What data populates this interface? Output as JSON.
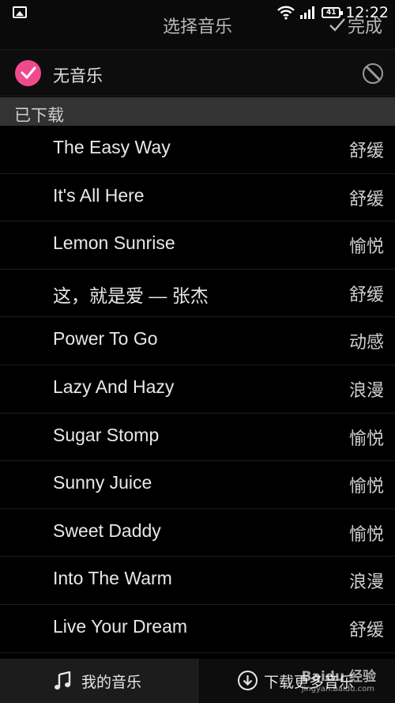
{
  "status_bar": {
    "time": "12:22",
    "battery": "41"
  },
  "header": {
    "title": "选择音乐",
    "done_label": "完成"
  },
  "no_music": {
    "label": "无音乐",
    "selected": true
  },
  "section": {
    "label": "已下载"
  },
  "tracks": [
    {
      "title": "The Easy Way",
      "mood": "舒缓"
    },
    {
      "title": "It's All Here",
      "mood": "舒缓"
    },
    {
      "title": "Lemon Sunrise",
      "mood": "愉悦"
    },
    {
      "title": "这，就是爱 — 张杰",
      "mood": "舒缓"
    },
    {
      "title": "Power To Go",
      "mood": "动感"
    },
    {
      "title": "Lazy And Hazy",
      "mood": "浪漫"
    },
    {
      "title": "Sugar Stomp",
      "mood": "愉悦"
    },
    {
      "title": "Sunny Juice",
      "mood": "愉悦"
    },
    {
      "title": "Sweet Daddy",
      "mood": "愉悦"
    },
    {
      "title": "Into The Warm",
      "mood": "浪漫"
    },
    {
      "title": "Live Your Dream",
      "mood": "舒缓"
    }
  ],
  "bottom_tabs": {
    "my_music": "我的音乐",
    "download_more": "下载更多音乐"
  },
  "watermark": {
    "brand": "Baidu 经验",
    "url": "jingyan.baidu.com"
  },
  "colors": {
    "accent": "#f04a8e",
    "background": "#000000",
    "section_bg": "#333333"
  },
  "icons": [
    "gallery-icon",
    "wifi-icon",
    "signal-icon",
    "battery-icon",
    "check-icon",
    "ban-icon",
    "music-note-icon",
    "download-icon"
  ]
}
